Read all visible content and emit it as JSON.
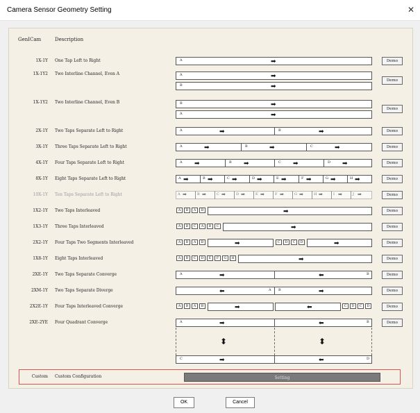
{
  "window": {
    "title": "Camera Sensor Geometry Setting",
    "close": "✕"
  },
  "header": {
    "gencam": "GenICam",
    "description": "Description"
  },
  "rows": [
    {
      "code": "1X-1Y",
      "desc": "One Tap Left to Right",
      "demo": "Demo"
    },
    {
      "code": "1X-1Y2",
      "desc": "Two Interline Channel, Even A",
      "demo": "Demo"
    },
    {
      "code": "1X-1Y2",
      "desc": "Two Interline Channel, Even B",
      "demo": "Demo"
    },
    {
      "code": "2X-1Y",
      "desc": "Two Taps Separate Left to Right",
      "demo": "Demo"
    },
    {
      "code": "3X-1Y",
      "desc": "Three Taps Separate Left to Right",
      "demo": "Demo"
    },
    {
      "code": "4X-1Y",
      "desc": "Four Taps Separate Left to Right",
      "demo": "Demo"
    },
    {
      "code": "8X-1Y",
      "desc": "Eight Taps Separate Left to Right",
      "demo": "Demo"
    },
    {
      "code": "10X-1Y",
      "desc": "Ten Taps Separate Left to Right",
      "demo": "Demo"
    },
    {
      "code": "1X2-1Y",
      "desc": "Two Taps Interleaved",
      "demo": "Demo"
    },
    {
      "code": "1X3-1Y",
      "desc": "Three Taps Interleaved",
      "demo": "Demo"
    },
    {
      "code": "2X2-1Y",
      "desc": "Four Taps Two Segments Interleaved",
      "demo": "Demo"
    },
    {
      "code": "1X8-1Y",
      "desc": "Eight Taps Interleaved",
      "demo": "Demo"
    },
    {
      "code": "2XE-1Y",
      "desc": "Two Taps Separate Converge",
      "demo": "Demo"
    },
    {
      "code": "2XM-1Y",
      "desc": "Two Taps Separate Diverge",
      "demo": "Demo"
    },
    {
      "code": "2X2E-1Y",
      "desc": "Four Taps Interleaved Converge",
      "demo": "Demo"
    },
    {
      "code": "2XE-2YE",
      "desc": "Four Quadrant Converge",
      "demo": "Demo"
    }
  ],
  "custom": {
    "code": "Custom",
    "desc": "Custom Configuration",
    "button": "Setting"
  },
  "footer": {
    "ok": "OK",
    "cancel": "Cancel"
  },
  "glyphs": {
    "A": "A",
    "B": "B",
    "C": "C",
    "D": "D",
    "E": "E",
    "F": "F",
    "G": "G",
    "H": "H",
    "I": "I",
    "J": "J",
    "right": "➡",
    "left": "⬅",
    "updown": "⬍"
  },
  "colors": {
    "highlight_border": "#d9534f",
    "setting_bg": "#7a7a7a",
    "panel_bg": "#f4f0e6"
  }
}
